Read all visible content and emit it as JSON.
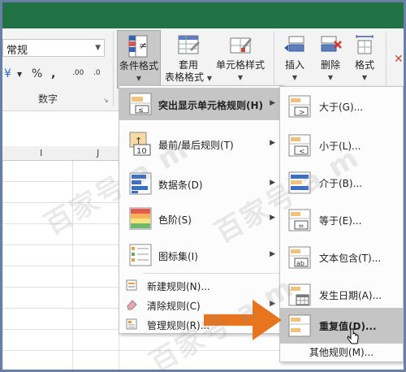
{
  "ribbon": {
    "number_format_value": "常规",
    "number_group_label": "数字",
    "number_tools": {
      "currency": "¥",
      "percent": "%",
      "comma": ",",
      "inc_decimal": ".00",
      "dec_decimal": ".0"
    },
    "conditional_format_label": "条件格式",
    "table_format_label_1": "套用",
    "table_format_label_2": "表格格式",
    "cell_styles_label": "单元格样式",
    "insert_label": "插入",
    "delete_label": "删除",
    "format_label": "格式"
  },
  "sheet": {
    "columns": [
      "I",
      "J"
    ]
  },
  "cf_menu": {
    "items": [
      {
        "label": "突出显示单元格规则(H)"
      },
      {
        "label": "最前/最后规则(T)"
      },
      {
        "label": "数据条(D)"
      },
      {
        "label": "色阶(S)"
      },
      {
        "label": "图标集(I)"
      }
    ],
    "small_items": [
      {
        "label": "新建规则(N)..."
      },
      {
        "label": "清除规则(C)"
      },
      {
        "label": "管理规则(R)..."
      }
    ]
  },
  "highlight_menu": {
    "items": [
      {
        "label": "大于(G)..."
      },
      {
        "label": "小于(L)..."
      },
      {
        "label": "介于(B)..."
      },
      {
        "label": "等于(E)..."
      },
      {
        "label": "文本包含(T)..."
      },
      {
        "label": "发生日期(A)..."
      },
      {
        "label": "重复值(D)..."
      }
    ],
    "more_rules": "其他规则(M)..."
  },
  "colors": {
    "title_green": "#217346",
    "highlight_gray": "#c5c5c5",
    "arrow_orange": "#e8741e"
  }
}
